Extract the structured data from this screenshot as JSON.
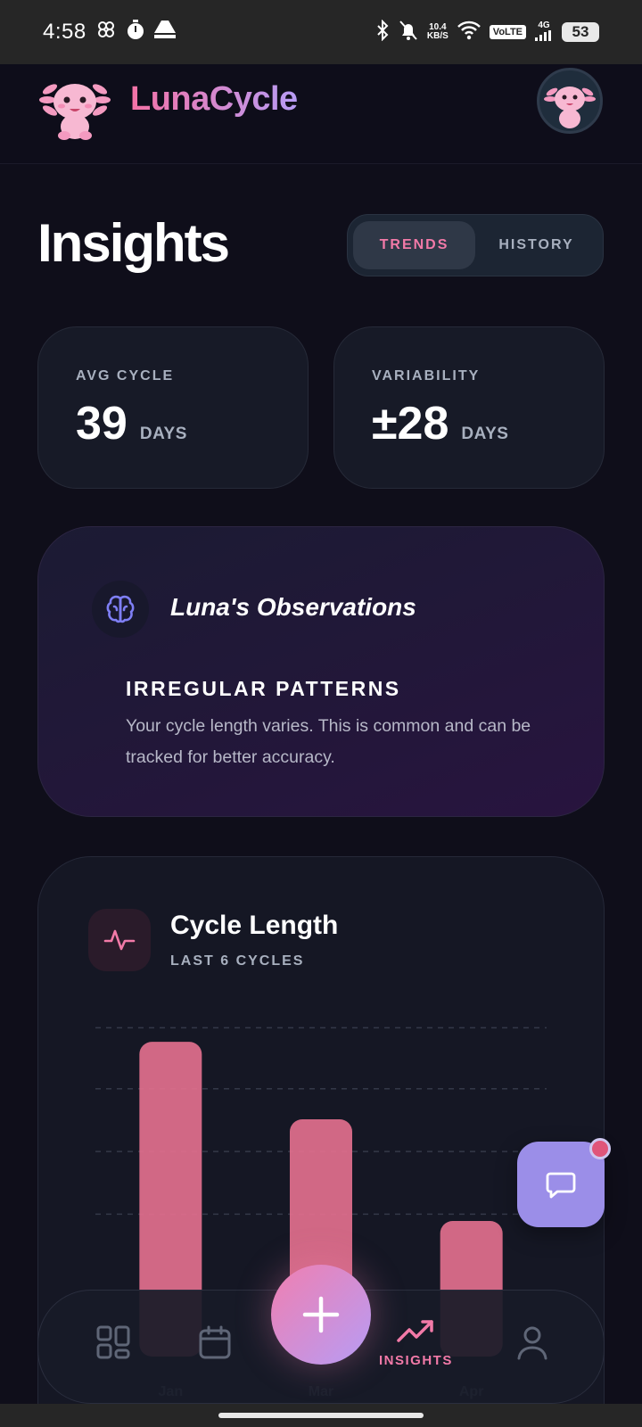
{
  "status_bar": {
    "time": "4:58",
    "net_speed_top": "10.4",
    "net_speed_bottom": "KB/S",
    "volte": "VoLTE",
    "network": "4G",
    "battery": "53"
  },
  "header": {
    "app_name": "LunaCycle"
  },
  "page": {
    "title": "Insights",
    "tabs": [
      {
        "label": "TRENDS",
        "active": true
      },
      {
        "label": "HISTORY",
        "active": false
      }
    ]
  },
  "stats": [
    {
      "label": "AVG CYCLE",
      "value": "39",
      "unit": "DAYS"
    },
    {
      "label": "VARIABILITY",
      "value": "±28",
      "unit": "DAYS"
    }
  ],
  "observations": {
    "title": "Luna's Observations",
    "heading": "IRREGULAR PATTERNS",
    "body": "Your cycle length varies. This is common and can be tracked for better accuracy."
  },
  "cycle_length": {
    "title": "Cycle Length",
    "subtitle": "LAST 6 CYCLES"
  },
  "chart_data": {
    "type": "bar",
    "categories": [
      "Jan",
      "Mar",
      "Apr"
    ],
    "values": [
      65,
      49,
      28
    ],
    "ylim": [
      0,
      70
    ],
    "grid": true,
    "bar_color": "#e2708e"
  },
  "nav": {
    "items": [
      {
        "name": "dashboard",
        "label": ""
      },
      {
        "name": "calendar",
        "label": ""
      },
      {
        "name": "insights",
        "label": "INSIGHTS",
        "active": true
      },
      {
        "name": "profile",
        "label": ""
      }
    ],
    "accent": "#f27aa8"
  }
}
